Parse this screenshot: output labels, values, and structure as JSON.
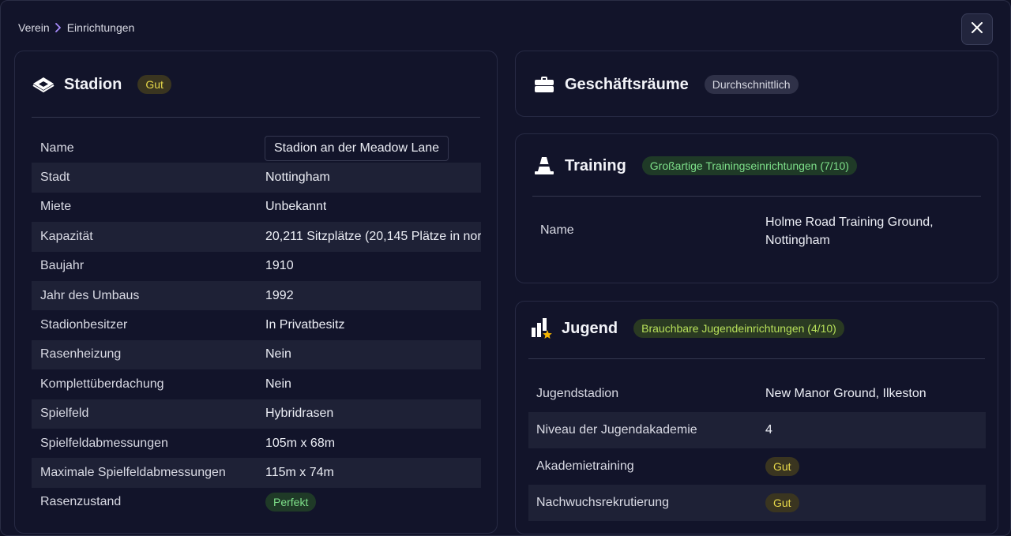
{
  "breadcrumb": {
    "parent": "Verein",
    "current": "Einrichtungen"
  },
  "stadium": {
    "title": "Stadion",
    "rating": "Gut",
    "rows": [
      {
        "key": "Name",
        "value": "Stadion an der Meadow Lane"
      },
      {
        "key": "Stadt",
        "value": "Nottingham"
      },
      {
        "key": "Miete",
        "value": "Unbekannt"
      },
      {
        "key": "Kapazität",
        "value": "20,211 Sitzplätze (20,145 Plätze in nor"
      },
      {
        "key": "Baujahr",
        "value": "1910"
      },
      {
        "key": "Jahr des Umbaus",
        "value": "1992"
      },
      {
        "key": "Stadionbesitzer",
        "value": "In Privatbesitz"
      },
      {
        "key": "Rasenheizung",
        "value": "Nein"
      },
      {
        "key": "Komplettüberdachung",
        "value": "Nein"
      },
      {
        "key": "Spielfeld",
        "value": "Hybridrasen"
      },
      {
        "key": "Spielfeldabmessungen",
        "value": "105m x 68m"
      },
      {
        "key": "Maximale Spielfeldabmessungen",
        "value": "115m x 74m"
      },
      {
        "key": "Rasenzustand",
        "value": "Perfekt"
      }
    ]
  },
  "business": {
    "title": "Geschäftsräume",
    "rating": "Durchschnittlich"
  },
  "training": {
    "title": "Training",
    "rating": "Großartige Trainingseinrichtungen (7/10)",
    "name_key": "Name",
    "name_line1": "Holme Road Training Ground,",
    "name_line2": "Nottingham"
  },
  "youth": {
    "title": "Jugend",
    "rating": "Brauchbare Jugendeinrichtungen (4/10)",
    "rows": [
      {
        "key": "Jugendstadion",
        "value": "New Manor Ground, Ilkeston"
      },
      {
        "key": "Niveau der Jugendakademie",
        "value": "4"
      },
      {
        "key": "Akademietraining",
        "value": "Gut"
      },
      {
        "key": "Nachwuchsrekrutierung",
        "value": "Gut"
      }
    ]
  },
  "icons": {
    "breadcrumb_sep": "chevron-right-icon",
    "close": "close-icon",
    "stadium": "stadium-icon",
    "business": "briefcase-icon",
    "training": "cone-icon",
    "youth": "youth-chart-icon"
  },
  "colors": {
    "background": "#12142a",
    "accent": "#a78bfa",
    "badge_yellow": "#e7d84a",
    "badge_green": "#7ee08a",
    "badge_lime": "#b7e05a"
  }
}
